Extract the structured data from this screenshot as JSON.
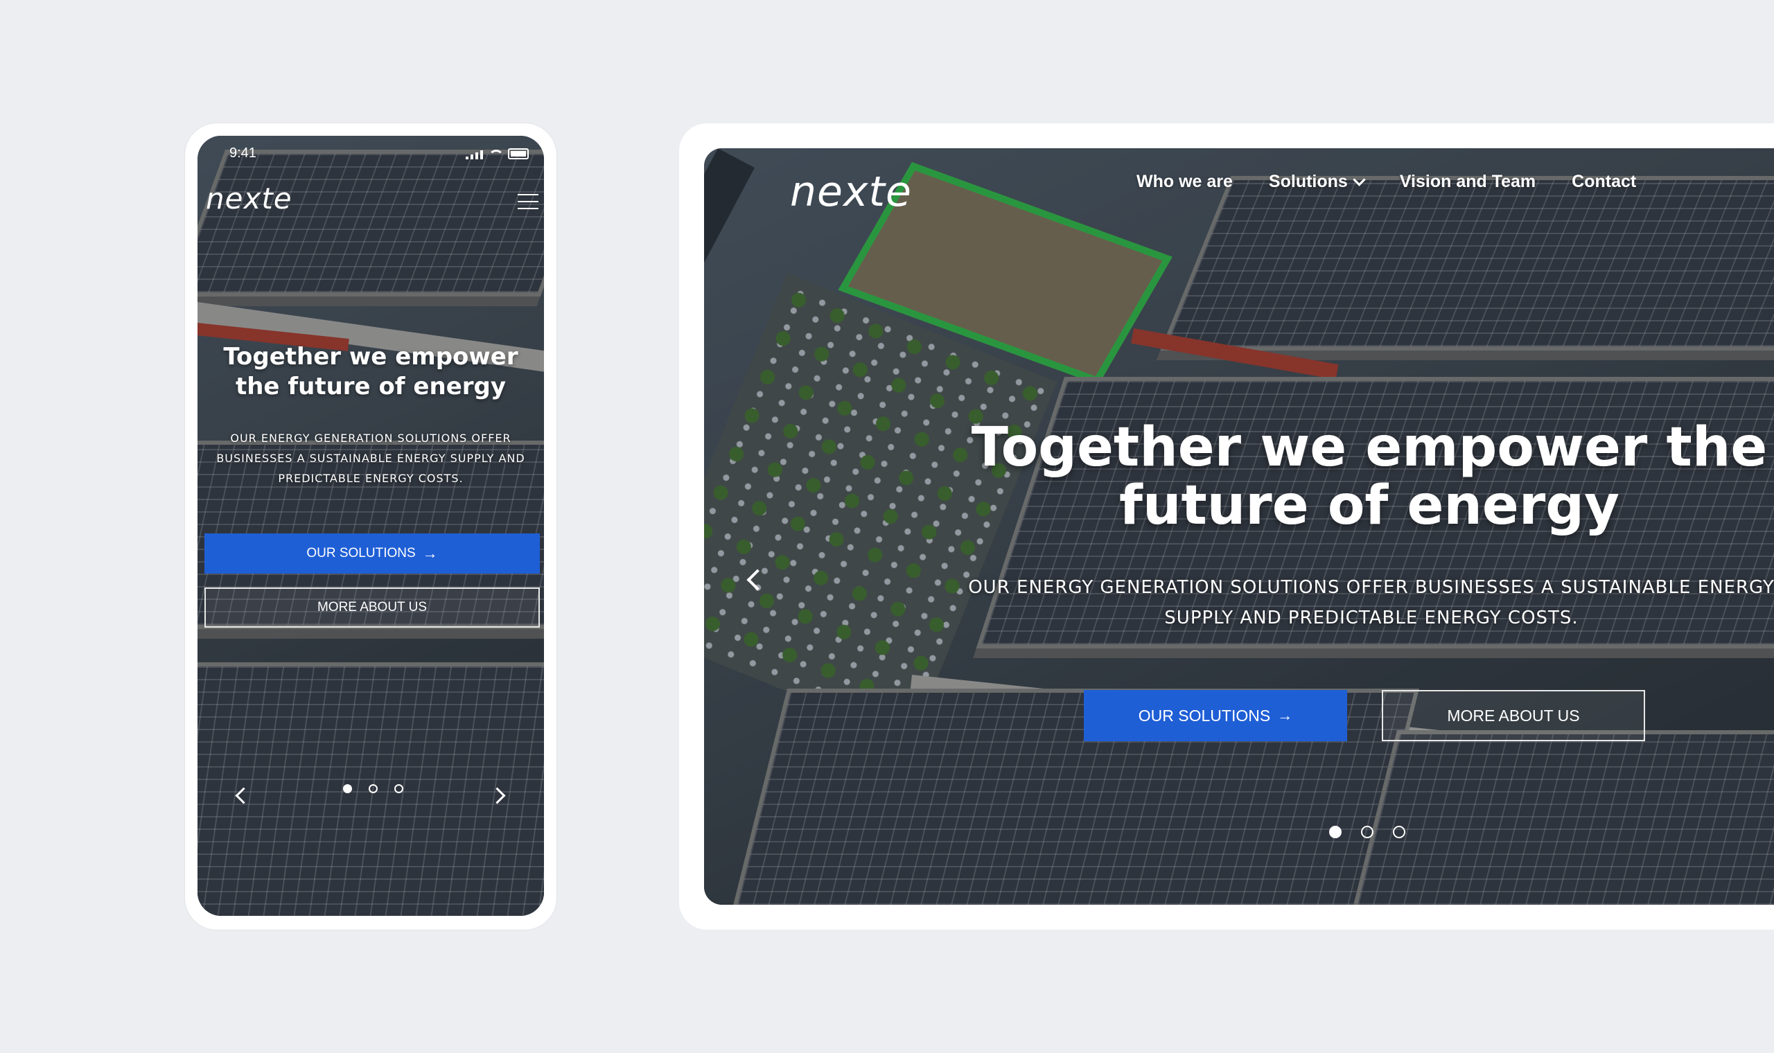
{
  "brand": {
    "logo_text": "nexte"
  },
  "mobile": {
    "status_time": "9:41",
    "headline": "Together we empower the future of energy",
    "subtext": "OUR ENERGY GENERATION SOLUTIONS OFFER BUSINESSES A SUSTAINABLE ENERGY SUPPLY AND PREDICTABLE ENERGY COSTS.",
    "primary_button": "OUR SOLUTIONS",
    "secondary_button": "MORE ABOUT US",
    "slide_count": 3,
    "active_slide": 1
  },
  "desktop": {
    "nav": [
      {
        "label": "Who we are"
      },
      {
        "label": "Solutions",
        "has_dropdown": true
      },
      {
        "label": "Vision and Team"
      },
      {
        "label": "Contact"
      }
    ],
    "headline": "Together we empower the future of energy",
    "subtext": "OUR ENERGY GENERATION SOLUTIONS OFFER BUSINESSES A SUSTAINABLE ENERGY SUPPLY AND PREDICTABLE ENERGY COSTS.",
    "primary_button": "OUR SOLUTIONS",
    "secondary_button": "MORE ABOUT US",
    "slide_count": 3,
    "active_slide": 1
  },
  "icons": {
    "button_arrow": "→",
    "menu": "hamburger-icon",
    "prev": "chevron-left-icon",
    "next": "chevron-right-icon",
    "dropdown": "chevron-down-icon"
  },
  "colors": {
    "background": "#edeef2",
    "primary_button": "#1f5fd6",
    "frame": "#ffffff",
    "court_fence": "#35c84a"
  }
}
